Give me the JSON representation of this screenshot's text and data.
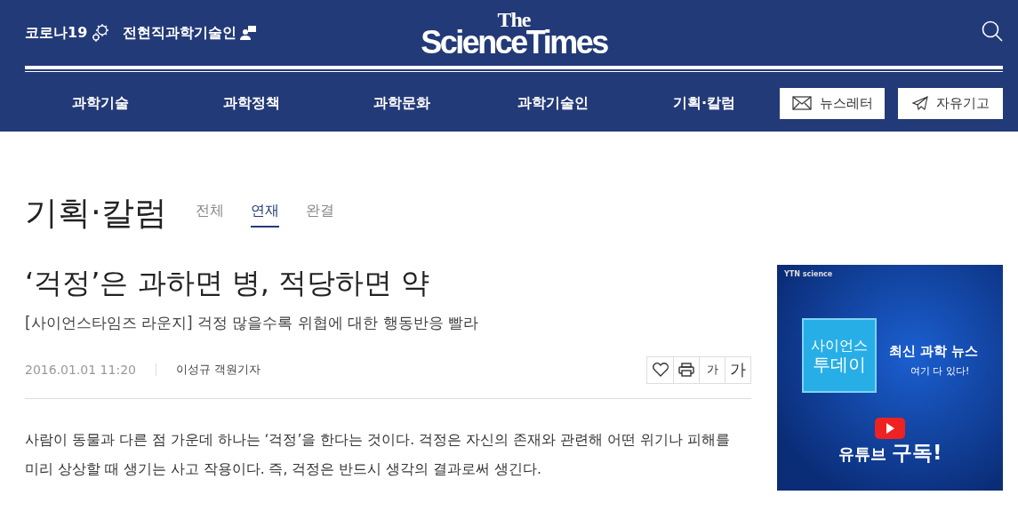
{
  "header": {
    "quick_links": [
      {
        "label": "코로나19",
        "kind": "virus"
      },
      {
        "label": "전현직과학기술인",
        "kind": "person"
      }
    ],
    "logo": {
      "top": "The",
      "bottom": "ScienceTimes"
    },
    "nav": [
      "과학기술",
      "과학정책",
      "과학문화",
      "과학기술인",
      "기획·칼럼"
    ],
    "buttons": [
      {
        "label": "뉴스레터",
        "kind": "mail"
      },
      {
        "label": "자유기고",
        "kind": "send"
      }
    ]
  },
  "section": {
    "title": "기획·칼럼",
    "tabs": [
      {
        "label": "전체",
        "selected": false
      },
      {
        "label": "연재",
        "selected": true
      },
      {
        "label": "완결",
        "selected": false
      }
    ]
  },
  "article": {
    "title": "‘걱정’은 과하면 병, 적당하면 약",
    "subtitle": "[사이언스타임즈 라운지] 걱정 많을수록 위협에 대한 행동반응 빨라",
    "date": "2016.01.01 11:20",
    "author": "이성규 객원기자",
    "tools": [
      {
        "kind": "heart"
      },
      {
        "kind": "print"
      },
      {
        "kind": "text-small",
        "label": "가"
      },
      {
        "kind": "text-large",
        "label": "가"
      }
    ],
    "body": "사람이 동물과 다른 점 가운데 하나는 ‘걱정’을 한다는 것이다. 걱정은 자신의 존재와 관련해 어떤 위기나 피해를 미리 상상할 때 생기는 사고 작용이다. 즉, 걱정은 반드시 생각의 결과로써 생긴다."
  },
  "ad": {
    "brand": "YTN science",
    "box": [
      "사이언스",
      "투데이"
    ],
    "headline": "최신 과학 뉴스",
    "tagline": "여기 다 있다!",
    "cta_light": "유튜브",
    "cta_bold": "구독!"
  }
}
